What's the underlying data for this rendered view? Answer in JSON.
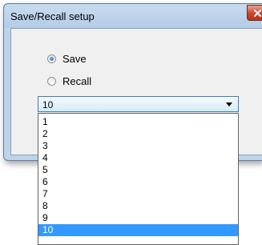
{
  "dialog": {
    "title": "Save/Recall setup",
    "close_icon": "close-x-icon",
    "close_color": "#c8452a"
  },
  "mode": {
    "options": [
      {
        "label": "Save",
        "checked": true
      },
      {
        "label": "Recall",
        "checked": false
      }
    ]
  },
  "slot_select": {
    "value": "10",
    "arrow_icon": "chevron-down-icon",
    "options": [
      "1",
      "2",
      "3",
      "4",
      "5",
      "6",
      "7",
      "8",
      "9",
      "10"
    ],
    "highlighted": "10",
    "highlight_color": "#3399ff"
  }
}
